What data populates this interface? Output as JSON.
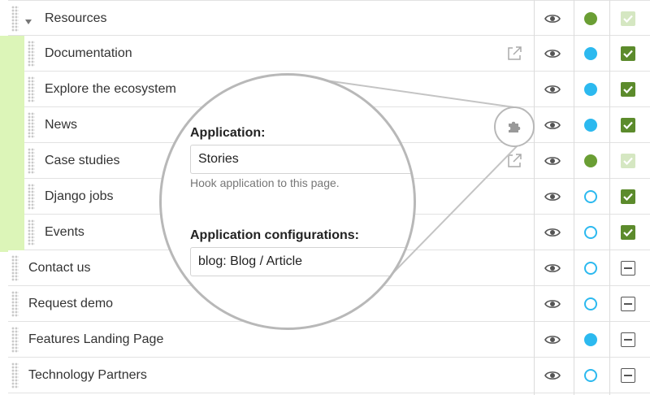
{
  "pages": [
    {
      "label": "Resources",
      "level": 0,
      "expanded": true,
      "status": "green",
      "check": "dim"
    },
    {
      "label": "Documentation",
      "level": 1,
      "status": "blue",
      "check": "on",
      "action": "external-link-icon"
    },
    {
      "label": "Explore the ecosystem",
      "level": 1,
      "status": "blue",
      "check": "on"
    },
    {
      "label": "News",
      "level": 1,
      "status": "blue",
      "check": "on",
      "action": "puzzle-icon"
    },
    {
      "label": "Case studies",
      "level": 1,
      "status": "green",
      "check": "dim",
      "action": "external-link-icon"
    },
    {
      "label": "Django jobs",
      "level": 1,
      "status": "ring",
      "check": "on"
    },
    {
      "label": "Events",
      "level": 1,
      "status": "ring",
      "check": "on"
    },
    {
      "label": "Contact us",
      "level": 0,
      "status": "ring",
      "check": "minus"
    },
    {
      "label": "Request demo",
      "level": 0,
      "status": "ring",
      "check": "minus"
    },
    {
      "label": "Features Landing Page",
      "level": 0,
      "status": "blue",
      "check": "minus"
    },
    {
      "label": "Technology Partners",
      "level": 0,
      "status": "ring",
      "check": "minus"
    }
  ],
  "colors": {
    "tree_highlight": "#dcf5b8",
    "published": "#6a9e34",
    "status_blue": "#2cb9ef",
    "checkbox_on": "#5c8b2c",
    "checkbox_dim": "#d5e7c2",
    "callout_border": "#b8b8b8"
  },
  "icons": {
    "visibility": "eye-icon",
    "expand": "caret-down-icon",
    "drag": "drag-handle-icon"
  },
  "callout": {
    "application_label": "Application:",
    "application_value": "Stories",
    "application_help": "Hook application to this page.",
    "config_label": "Application configurations:",
    "config_value": "blog: Blog / Article"
  }
}
